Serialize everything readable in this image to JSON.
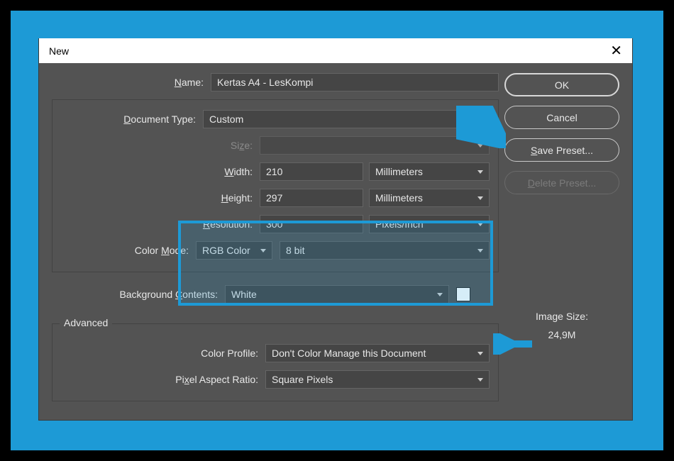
{
  "dialog": {
    "title": "New",
    "name_label": "Name:",
    "name_value": "Kertas A4 - LesKompi",
    "doc_type_label": "Document Type:",
    "doc_type_value": "Custom",
    "size_label": "Size:",
    "size_value": "",
    "width_label": "Width:",
    "width_value": "210",
    "width_unit": "Millimeters",
    "height_label": "Height:",
    "height_value": "297",
    "height_unit": "Millimeters",
    "resolution_label": "Resolution:",
    "resolution_value": "300",
    "resolution_unit": "Pixels/Inch",
    "color_mode_label": "Color Mode:",
    "color_mode_value": "RGB Color",
    "color_depth_value": "8 bit",
    "bg_label": "Background Contents:",
    "bg_value": "White",
    "advanced_legend": "Advanced",
    "color_profile_label": "Color Profile:",
    "color_profile_value": "Don't Color Manage this Document",
    "par_label": "Pixel Aspect Ratio:",
    "par_value": "Square Pixels"
  },
  "buttons": {
    "ok": "OK",
    "cancel": "Cancel",
    "save_preset": "Save Preset...",
    "delete_preset": "Delete Preset..."
  },
  "image_size": {
    "label": "Image Size:",
    "value": "24,9M"
  }
}
